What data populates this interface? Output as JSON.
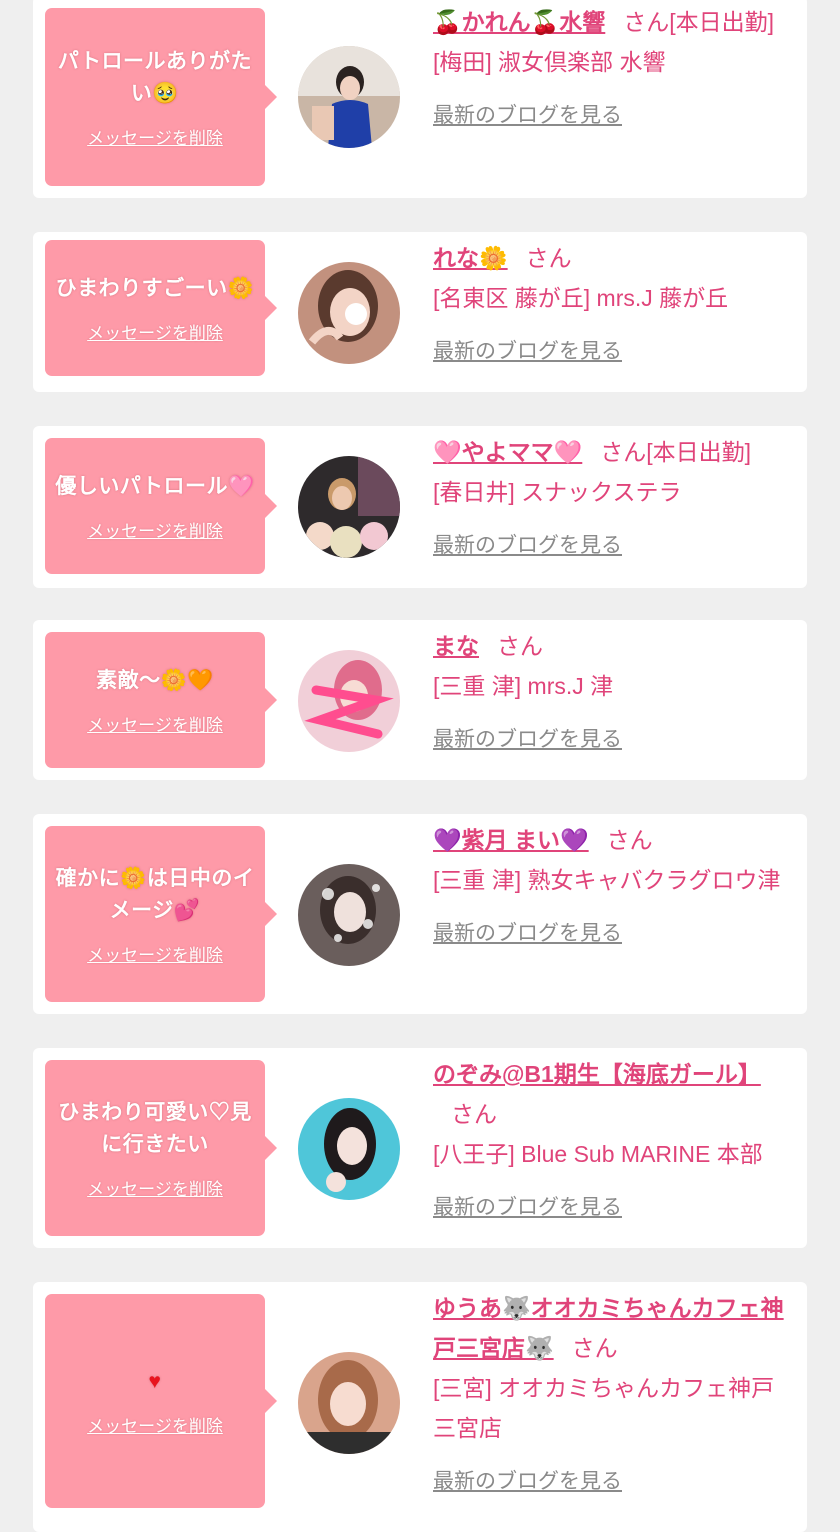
{
  "delete_label": "メッセージを削除",
  "blog_label": "最新のブログを見る",
  "san_label": "さん",
  "colors": {
    "bubble": "#fe9aa8",
    "accent": "#e0447a",
    "link_gray": "#8a8a8a",
    "page_bg": "#efefef"
  },
  "items": [
    {
      "message": "パトロールありがたい🥹",
      "name": "🍒かれん🍒水響",
      "status": "[本日出勤]",
      "shop": "[梅田] 淑女倶楽部 水響"
    },
    {
      "message": "ひまわりすごーい🌼",
      "name": "れな🌼",
      "status": "",
      "shop": "[名東区 藤が丘] mrs.J 藤が丘"
    },
    {
      "message": "優しいパトロール🩷",
      "name": "🩷やよママ🩷",
      "status": "[本日出勤]",
      "shop": "[春日井] スナックステラ"
    },
    {
      "message": "素敵〜🌼🧡",
      "name": "まな",
      "status": "",
      "shop": "[三重 津] mrs.J 津"
    },
    {
      "message": "確かに🌼は日中のイメージ💕",
      "name": "💜紫月 まい💜",
      "status": "",
      "shop": "[三重 津] 熟女キャバクラグロウ津"
    },
    {
      "message": "ひまわり可愛い♡見に行きたい",
      "name": "のぞみ@B1期生【海底ガール】",
      "status": "",
      "shop": "[八王子] Blue Sub MARINE 本部"
    },
    {
      "message": "♥",
      "name": "ゆうあ🐺オオカミちゃんカフェ神戸三宮店🐺",
      "status": "",
      "shop": "[三宮] オオカミちゃんカフェ神戸三宮店"
    }
  ]
}
